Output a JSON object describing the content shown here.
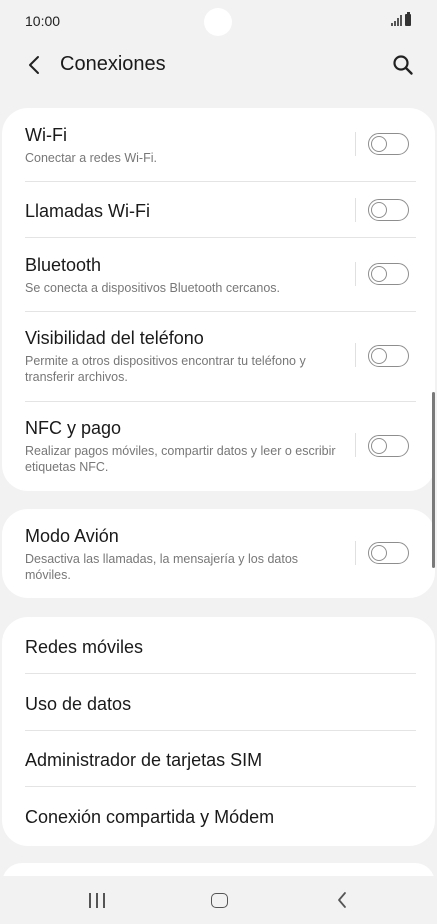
{
  "status_bar": {
    "time": "10:00",
    "icons": [
      "signal-icon",
      "battery-icon"
    ]
  },
  "header": {
    "title": "Conexiones",
    "back_icon": "chevron-left-icon",
    "search_icon": "search-icon"
  },
  "sections": {
    "wifi": {
      "title": "Wi-Fi",
      "subtitle": "Conectar a redes Wi-Fi.",
      "enabled": false
    },
    "wifi_calling": {
      "title": "Llamadas Wi-Fi",
      "enabled": false
    },
    "bluetooth": {
      "title": "Bluetooth",
      "subtitle": "Se conecta a dispositivos Bluetooth cercanos.",
      "enabled": false
    },
    "visibility": {
      "title": "Visibilidad del teléfono",
      "subtitle": "Permite a otros dispositivos encontrar tu teléfono y transferir archivos.",
      "enabled": false
    },
    "nfc": {
      "title": "NFC y pago",
      "subtitle": "Realizar pagos móviles, compartir datos y leer o escribir etiquetas NFC.",
      "enabled": false
    },
    "airplane": {
      "title": "Modo Avión",
      "subtitle": "Desactiva las llamadas, la mensajería y los datos móviles.",
      "enabled": false
    }
  },
  "menu_items": [
    {
      "label": "Redes móviles"
    },
    {
      "label": "Uso de datos"
    },
    {
      "label": "Administrador de tarjetas SIM"
    },
    {
      "label": "Conexión compartida y Módem"
    }
  ],
  "nav_bar": {
    "recent_icon": "recent-apps-icon",
    "home_icon": "home-icon",
    "back_icon": "back-icon"
  },
  "colors": {
    "background": "#f2f2f2",
    "card": "#ffffff",
    "toggle_off": "#8e8e8e",
    "subtitle": "#777777"
  }
}
